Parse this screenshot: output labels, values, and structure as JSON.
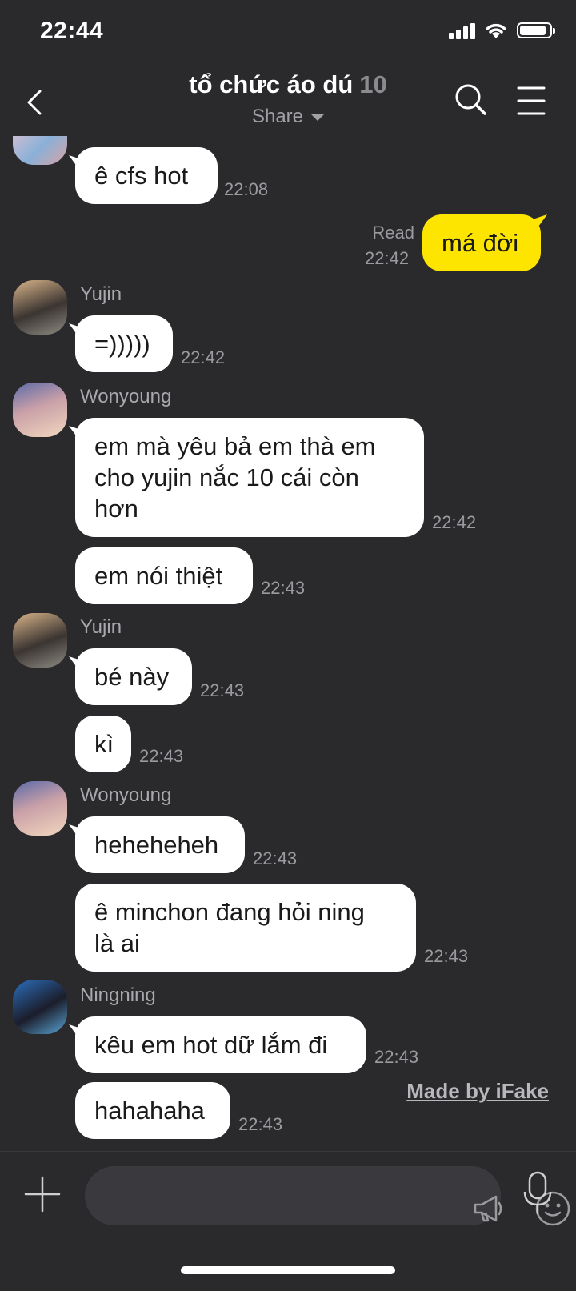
{
  "status_bar": {
    "time": "22:44",
    "battery_level": 0.9
  },
  "header": {
    "title": "tổ chức áo dú",
    "member_count": "10",
    "subtitle": "Share"
  },
  "messages": [
    {
      "type": "other",
      "text": "ê cfs hot",
      "time": "22:08"
    },
    {
      "type": "me",
      "read_label": "Read",
      "text": "má đời",
      "time": "22:42"
    },
    {
      "type": "other",
      "sender": "Yujin",
      "text": "=)))))",
      "time": "22:42"
    },
    {
      "type": "other",
      "sender": "Wonyoung",
      "text": "em mà yêu bả em thà em\ncho yujin nắc 10 cái còn\nhơn",
      "time": "22:42"
    },
    {
      "type": "other",
      "text": "em nói thiệt",
      "time": "22:43"
    },
    {
      "type": "other",
      "sender": "Yujin",
      "text": "bé này",
      "time": "22:43"
    },
    {
      "type": "other",
      "text": "kì",
      "time": "22:43"
    },
    {
      "type": "other",
      "sender": "Wonyoung",
      "text": "heheheheh",
      "time": "22:43"
    },
    {
      "type": "other",
      "text": "ê minchon đang hỏi ning\nlà ai",
      "time": "22:43"
    },
    {
      "type": "other",
      "sender": "Ningning",
      "text": "kêu em hot dữ lắm đi",
      "time": "22:43"
    },
    {
      "type": "other",
      "text": "hahahaha",
      "time": "22:43"
    }
  ],
  "watermark": "Made by iFake",
  "icons": [
    "back-icon",
    "search-icon",
    "menu-icon",
    "plus-icon",
    "megaphone-icon",
    "emoji-icon",
    "mic-icon"
  ],
  "colors": {
    "background": "#2a2a2d",
    "my_bubble": "#fee500",
    "other_bubble": "#ffffff"
  }
}
